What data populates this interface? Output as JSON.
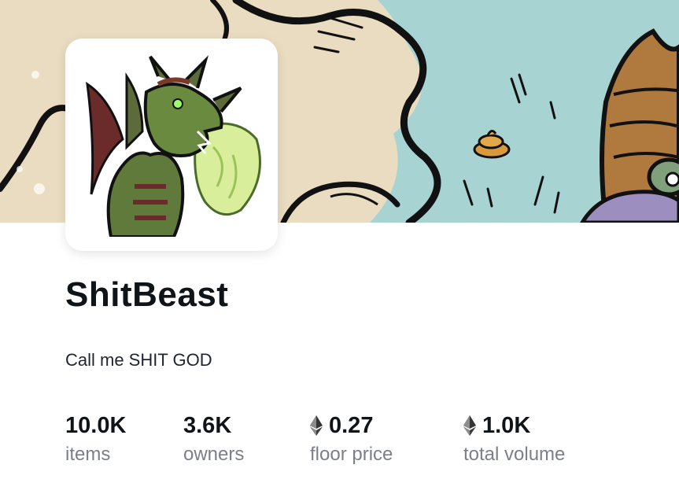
{
  "collection": {
    "name": "ShitBeast",
    "description": "Call me SHIT GOD"
  },
  "stats": [
    {
      "value": "10.0K",
      "label": "items",
      "currency_icon": null
    },
    {
      "value": "3.6K",
      "label": "owners",
      "currency_icon": null
    },
    {
      "value": "0.27",
      "label": "floor price",
      "currency_icon": "ethereum-icon"
    },
    {
      "value": "1.0K",
      "label": "total volume",
      "currency_icon": "ethereum-icon"
    }
  ],
  "colors": {
    "banner_cream": "#e9dcc0",
    "banner_sky": "#a8d3d3",
    "label_gray": "#7b7f86",
    "text_dark": "#0f1419"
  }
}
